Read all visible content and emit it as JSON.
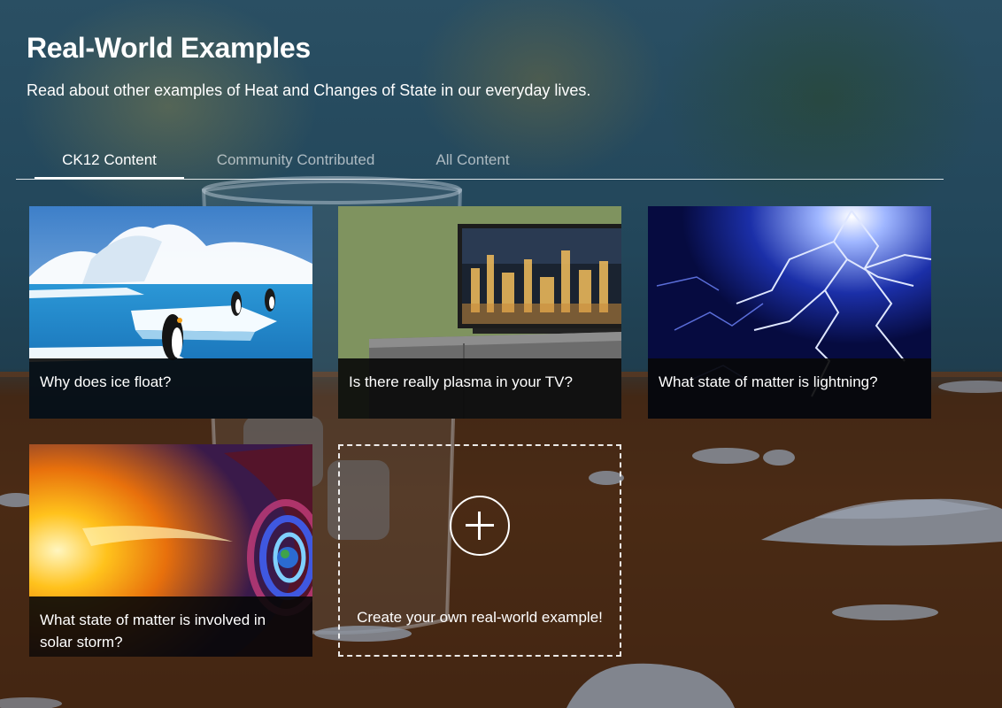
{
  "header": {
    "title": "Real-World Examples",
    "subtitle": "Read about other examples of Heat and Changes of State in our everyday lives."
  },
  "tabs": [
    {
      "label": "CK12 Content",
      "active": true
    },
    {
      "label": "Community Contributed",
      "active": false
    },
    {
      "label": "All Content",
      "active": false
    }
  ],
  "cards": [
    {
      "title": "Why does ice float?"
    },
    {
      "title": "Is there really plasma in your TV?"
    },
    {
      "title": "What state of matter is lightning?"
    },
    {
      "title": "What state of matter is involved in solar storm?"
    }
  ],
  "create_card": {
    "label": "Create your own real-world example!",
    "icon": "plus-circle-icon"
  },
  "colors": {
    "tab_active": "#ffffff",
    "tab_inactive": "#a8b4bb",
    "caption_background": "#080808"
  }
}
